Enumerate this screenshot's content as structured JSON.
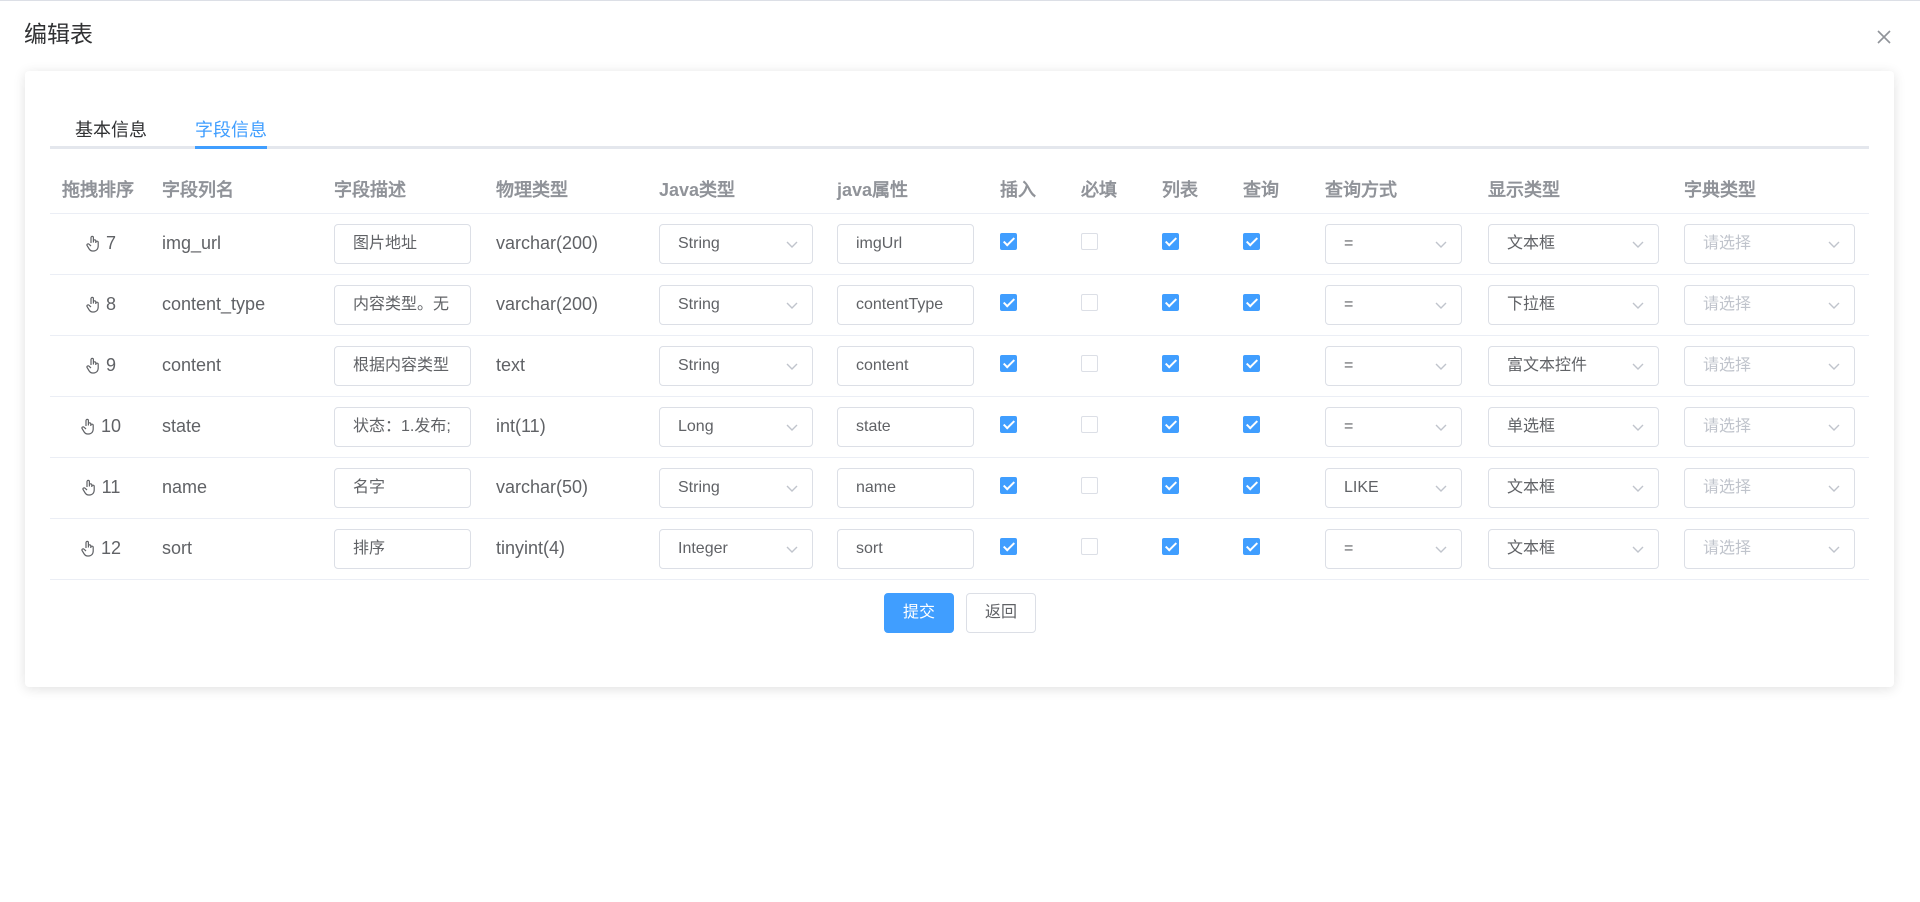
{
  "dialog": {
    "title": "编辑表"
  },
  "tabs": [
    {
      "label": "基本信息",
      "active": false
    },
    {
      "label": "字段信息",
      "active": true
    }
  ],
  "columns": [
    "拖拽排序",
    "字段列名",
    "字段描述",
    "物理类型",
    "Java类型",
    "java属性",
    "插入",
    "必填",
    "列表",
    "查询",
    "查询方式",
    "显示类型",
    "字典类型"
  ],
  "rows": [
    {
      "sort": "7",
      "column": "img_url",
      "desc": "图片地址",
      "physical": "varchar(200)",
      "java_type": "String",
      "java_prop": "imgUrl",
      "insert": true,
      "required": false,
      "list": true,
      "query": true,
      "query_type": "=",
      "display": "文本框",
      "dict": "请选择"
    },
    {
      "sort": "8",
      "column": "content_type",
      "desc": "内容类型。无",
      "physical": "varchar(200)",
      "java_type": "String",
      "java_prop": "contentType",
      "insert": true,
      "required": false,
      "list": true,
      "query": true,
      "query_type": "=",
      "display": "下拉框",
      "dict": "请选择"
    },
    {
      "sort": "9",
      "column": "content",
      "desc": "根据内容类型",
      "physical": "text",
      "java_type": "String",
      "java_prop": "content",
      "insert": true,
      "required": false,
      "list": true,
      "query": true,
      "query_type": "=",
      "display": "富文本控件",
      "dict": "请选择"
    },
    {
      "sort": "10",
      "column": "state",
      "desc": "状态：1.发布;",
      "physical": "int(11)",
      "java_type": "Long",
      "java_prop": "state",
      "insert": true,
      "required": false,
      "list": true,
      "query": true,
      "query_type": "=",
      "display": "单选框",
      "dict": "请选择"
    },
    {
      "sort": "11",
      "column": "name",
      "desc": "名字",
      "physical": "varchar(50)",
      "java_type": "String",
      "java_prop": "name",
      "insert": true,
      "required": false,
      "list": true,
      "query": true,
      "query_type": "LIKE",
      "display": "文本框",
      "dict": "请选择"
    },
    {
      "sort": "12",
      "column": "sort",
      "desc": "排序",
      "physical": "tinyint(4)",
      "java_type": "Integer",
      "java_prop": "sort",
      "insert": true,
      "required": false,
      "list": true,
      "query": true,
      "query_type": "=",
      "display": "文本框",
      "dict": "请选择"
    }
  ],
  "actions": {
    "submit_label": "提交",
    "back_label": "返回"
  },
  "colors": {
    "primary": "#409eff",
    "border": "#dcdfe6"
  }
}
